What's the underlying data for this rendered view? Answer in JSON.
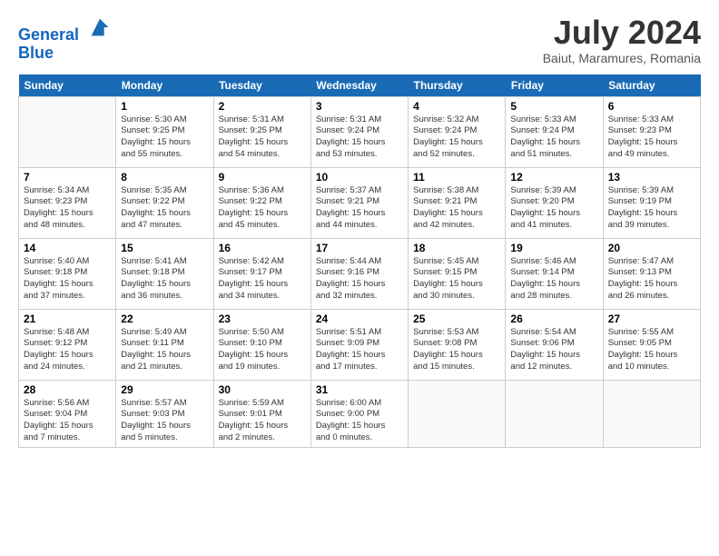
{
  "header": {
    "logo_line1": "General",
    "logo_line2": "Blue",
    "title": "July 2024",
    "subtitle": "Baiut, Maramures, Romania"
  },
  "days_of_week": [
    "Sunday",
    "Monday",
    "Tuesday",
    "Wednesday",
    "Thursday",
    "Friday",
    "Saturday"
  ],
  "weeks": [
    [
      {
        "num": "",
        "content": ""
      },
      {
        "num": "1",
        "content": "Sunrise: 5:30 AM\nSunset: 9:25 PM\nDaylight: 15 hours\nand 55 minutes."
      },
      {
        "num": "2",
        "content": "Sunrise: 5:31 AM\nSunset: 9:25 PM\nDaylight: 15 hours\nand 54 minutes."
      },
      {
        "num": "3",
        "content": "Sunrise: 5:31 AM\nSunset: 9:24 PM\nDaylight: 15 hours\nand 53 minutes."
      },
      {
        "num": "4",
        "content": "Sunrise: 5:32 AM\nSunset: 9:24 PM\nDaylight: 15 hours\nand 52 minutes."
      },
      {
        "num": "5",
        "content": "Sunrise: 5:33 AM\nSunset: 9:24 PM\nDaylight: 15 hours\nand 51 minutes."
      },
      {
        "num": "6",
        "content": "Sunrise: 5:33 AM\nSunset: 9:23 PM\nDaylight: 15 hours\nand 49 minutes."
      }
    ],
    [
      {
        "num": "7",
        "content": "Sunrise: 5:34 AM\nSunset: 9:23 PM\nDaylight: 15 hours\nand 48 minutes."
      },
      {
        "num": "8",
        "content": "Sunrise: 5:35 AM\nSunset: 9:22 PM\nDaylight: 15 hours\nand 47 minutes."
      },
      {
        "num": "9",
        "content": "Sunrise: 5:36 AM\nSunset: 9:22 PM\nDaylight: 15 hours\nand 45 minutes."
      },
      {
        "num": "10",
        "content": "Sunrise: 5:37 AM\nSunset: 9:21 PM\nDaylight: 15 hours\nand 44 minutes."
      },
      {
        "num": "11",
        "content": "Sunrise: 5:38 AM\nSunset: 9:21 PM\nDaylight: 15 hours\nand 42 minutes."
      },
      {
        "num": "12",
        "content": "Sunrise: 5:39 AM\nSunset: 9:20 PM\nDaylight: 15 hours\nand 41 minutes."
      },
      {
        "num": "13",
        "content": "Sunrise: 5:39 AM\nSunset: 9:19 PM\nDaylight: 15 hours\nand 39 minutes."
      }
    ],
    [
      {
        "num": "14",
        "content": "Sunrise: 5:40 AM\nSunset: 9:18 PM\nDaylight: 15 hours\nand 37 minutes."
      },
      {
        "num": "15",
        "content": "Sunrise: 5:41 AM\nSunset: 9:18 PM\nDaylight: 15 hours\nand 36 minutes."
      },
      {
        "num": "16",
        "content": "Sunrise: 5:42 AM\nSunset: 9:17 PM\nDaylight: 15 hours\nand 34 minutes."
      },
      {
        "num": "17",
        "content": "Sunrise: 5:44 AM\nSunset: 9:16 PM\nDaylight: 15 hours\nand 32 minutes."
      },
      {
        "num": "18",
        "content": "Sunrise: 5:45 AM\nSunset: 9:15 PM\nDaylight: 15 hours\nand 30 minutes."
      },
      {
        "num": "19",
        "content": "Sunrise: 5:46 AM\nSunset: 9:14 PM\nDaylight: 15 hours\nand 28 minutes."
      },
      {
        "num": "20",
        "content": "Sunrise: 5:47 AM\nSunset: 9:13 PM\nDaylight: 15 hours\nand 26 minutes."
      }
    ],
    [
      {
        "num": "21",
        "content": "Sunrise: 5:48 AM\nSunset: 9:12 PM\nDaylight: 15 hours\nand 24 minutes."
      },
      {
        "num": "22",
        "content": "Sunrise: 5:49 AM\nSunset: 9:11 PM\nDaylight: 15 hours\nand 21 minutes."
      },
      {
        "num": "23",
        "content": "Sunrise: 5:50 AM\nSunset: 9:10 PM\nDaylight: 15 hours\nand 19 minutes."
      },
      {
        "num": "24",
        "content": "Sunrise: 5:51 AM\nSunset: 9:09 PM\nDaylight: 15 hours\nand 17 minutes."
      },
      {
        "num": "25",
        "content": "Sunrise: 5:53 AM\nSunset: 9:08 PM\nDaylight: 15 hours\nand 15 minutes."
      },
      {
        "num": "26",
        "content": "Sunrise: 5:54 AM\nSunset: 9:06 PM\nDaylight: 15 hours\nand 12 minutes."
      },
      {
        "num": "27",
        "content": "Sunrise: 5:55 AM\nSunset: 9:05 PM\nDaylight: 15 hours\nand 10 minutes."
      }
    ],
    [
      {
        "num": "28",
        "content": "Sunrise: 5:56 AM\nSunset: 9:04 PM\nDaylight: 15 hours\nand 7 minutes."
      },
      {
        "num": "29",
        "content": "Sunrise: 5:57 AM\nSunset: 9:03 PM\nDaylight: 15 hours\nand 5 minutes."
      },
      {
        "num": "30",
        "content": "Sunrise: 5:59 AM\nSunset: 9:01 PM\nDaylight: 15 hours\nand 2 minutes."
      },
      {
        "num": "31",
        "content": "Sunrise: 6:00 AM\nSunset: 9:00 PM\nDaylight: 15 hours\nand 0 minutes."
      },
      {
        "num": "",
        "content": ""
      },
      {
        "num": "",
        "content": ""
      },
      {
        "num": "",
        "content": ""
      }
    ]
  ]
}
